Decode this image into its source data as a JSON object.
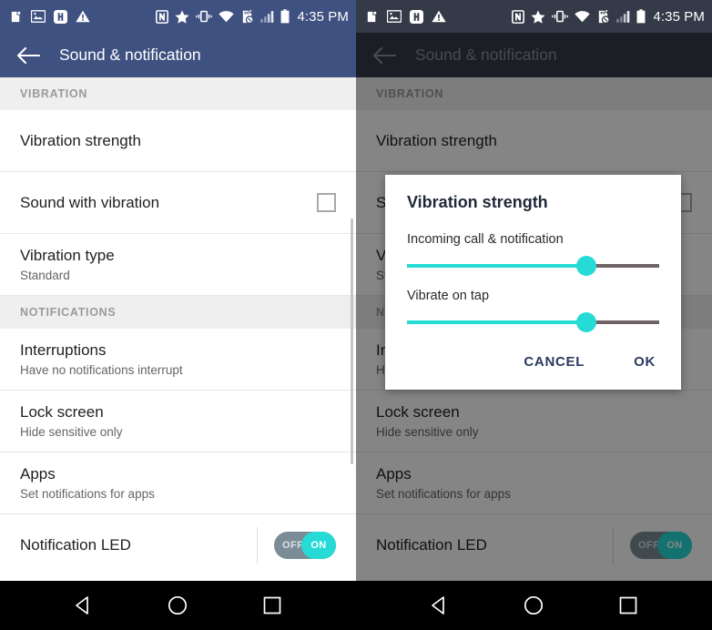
{
  "status_bar": {
    "time": "4:35 PM",
    "left_icons": [
      "usb-debug-icon",
      "screenshot-image-icon",
      "h-badge-icon",
      "warning-triangle-icon"
    ],
    "right_icons": [
      "nfc-icon",
      "star-icon",
      "vibrate-icon",
      "wifi-icon",
      "sd-card-removed-icon",
      "signal-bars-icon",
      "battery-icon"
    ]
  },
  "toolbar": {
    "title": "Sound & notification",
    "back_icon": "back-arrow-icon"
  },
  "sections": [
    {
      "header": "VIBRATION",
      "rows": [
        {
          "title": "Vibration strength",
          "sub": "",
          "control": "none"
        },
        {
          "title": "Sound with vibration",
          "sub": "",
          "control": "checkbox",
          "checked": false
        },
        {
          "title": "Vibration type",
          "sub": "Standard",
          "control": "none"
        }
      ]
    },
    {
      "header": "NOTIFICATIONS",
      "rows": [
        {
          "title": "Interruptions",
          "sub": "Have no notifications interrupt",
          "control": "none"
        },
        {
          "title": "Lock screen",
          "sub": "Hide sensitive only",
          "control": "none"
        },
        {
          "title": "Apps",
          "sub": "Set notifications for apps",
          "control": "none"
        },
        {
          "title": "Notification LED",
          "sub": "",
          "control": "toggle",
          "toggle_off_label": "OFF",
          "toggle_on_label": "ON",
          "toggle_state": "ON"
        }
      ]
    }
  ],
  "nav_bar": {
    "back": "nav-back-triangle-icon",
    "home": "nav-home-circle-icon",
    "recents": "nav-recents-square-icon"
  },
  "dialog": {
    "title": "Vibration strength",
    "sliders": [
      {
        "label": "Incoming call & notification",
        "value_percent": 71
      },
      {
        "label": "Vibrate on tap",
        "value_percent": 71
      }
    ],
    "cancel_label": "CANCEL",
    "ok_label": "OK"
  },
  "colors": {
    "toolbar": "#3f5180",
    "toolbar_dim": "#343a47",
    "accent_teal": "#26dbd6",
    "section_header_bg": "#efefef",
    "dialog_button": "#2b3a5e",
    "slider_track": "#6e6264",
    "toggle_track": "#7a8c96"
  }
}
